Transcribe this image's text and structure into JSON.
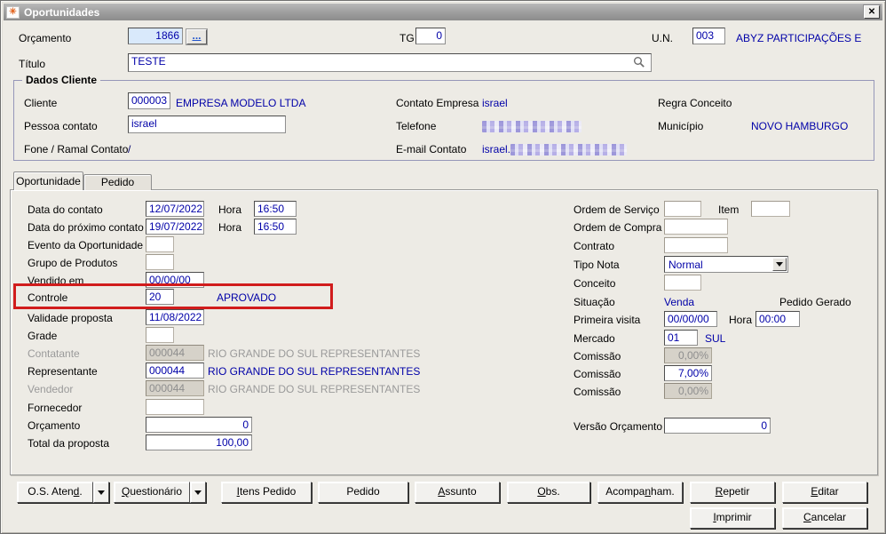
{
  "window": {
    "title": "Oportunidades"
  },
  "icons": {
    "app": "✳",
    "close": "✕"
  },
  "colors": {
    "value_text": "#0000A8",
    "highlight_red": "#D11C1C",
    "disabled_text": "#8E8E8E",
    "orcamento_bg": "#D9E9FB"
  },
  "header": {
    "orcamento_label": "Orçamento",
    "orcamento_value": "1866",
    "browse_label": "...",
    "tg_label": "TG",
    "tg_value": "0",
    "un_label": "U.N.",
    "un_value": "003",
    "un_name": "ABYZ PARTICIPAÇÕES E",
    "titulo_label": "Título",
    "titulo_value": "TESTE"
  },
  "cliente": {
    "legend": "Dados Cliente",
    "cliente_label": "Cliente",
    "cliente_code": "000003",
    "cliente_name": "EMPRESA MODELO LTDA",
    "pessoa_label": "Pessoa contato",
    "pessoa_value": "israel",
    "fone_label": "Fone / Ramal Contato",
    "fone_value": "/",
    "contato_label": "Contato Empresa",
    "contato_value": "israel",
    "telefone_label": "Telefone",
    "email_label": "E-mail Contato",
    "email_prefix": "israel.",
    "regra_label": "Regra Conceito",
    "municipio_label": "Município",
    "municipio_value": "NOVO HAMBURGO"
  },
  "tabs": {
    "oportunidade": "Oportunidade",
    "pedido": "Pedido"
  },
  "left": {
    "data_contato_label": "Data do contato",
    "data_contato": "12/07/2022",
    "hora_label": "Hora",
    "hora1": "16:50",
    "data_prox_label": "Data do próximo contato",
    "data_prox": "19/07/2022",
    "hora2": "16:50",
    "evento_label": "Evento da Oportunidade",
    "grupo_label": "Grupo de Produtos",
    "vendido_label": "Vendido em",
    "vendido": "00/00/00",
    "controle_label": "Controle",
    "controle": "20",
    "controle_status": "APROVADO",
    "validade_label": "Validade proposta",
    "validade": "11/08/2022",
    "grade_label": "Grade",
    "contatante_label": "Contatante",
    "contatante_code": "000044",
    "contatante_name": "RIO GRANDE DO SUL REPRESENTANTES",
    "representante_label": "Representante",
    "representante_code": "000044",
    "representante_name": "RIO GRANDE DO SUL REPRESENTANTES",
    "vendedor_label": "Vendedor",
    "vendedor_code": "000044",
    "vendedor_name": "RIO GRANDE DO SUL REPRESENTANTES",
    "fornecedor_label": "Fornecedor",
    "orcamento_label": "Orçamento",
    "orcamento": "0",
    "total_label": "Total da proposta",
    "total": "100,00"
  },
  "right": {
    "os_label": "Ordem de Serviço",
    "item_label": "Item",
    "oc_label": "Ordem de Compra",
    "contrato_label": "Contrato",
    "tipo_nota_label": "Tipo Nota",
    "tipo_nota": "Normal",
    "conceito_label": "Conceito",
    "situacao_label": "Situação",
    "situacao": "Venda",
    "pedido_gerado_label": "Pedido Gerado",
    "visita_label": "Primeira visita",
    "visita": "00/00/00",
    "hora_label": "Hora",
    "visita_hora": "00:00",
    "mercado_label": "Mercado",
    "mercado": "01",
    "mercado_name": "SUL",
    "comissao_label": "Comissão",
    "comissao1": "0,00%",
    "comissao2": "7,00%",
    "comissao3": "0,00%",
    "versao_label": "Versão Orçamento",
    "versao": "0"
  },
  "buttons": [
    {
      "pre": "O.S. Aten",
      "accel": "d",
      "post": "."
    },
    {
      "pre": "",
      "accel": "Q",
      "post": "uestionário"
    },
    {
      "pre": "",
      "accel": "I",
      "post": "tens Pedido"
    },
    {
      "pre": "Pedido",
      "accel": "",
      "post": ""
    },
    {
      "pre": "",
      "accel": "A",
      "post": "ssunto"
    },
    {
      "pre": "",
      "accel": "O",
      "post": "bs."
    },
    {
      "pre": "Acompa",
      "accel": "n",
      "post": "ham."
    },
    {
      "pre": "",
      "accel": "R",
      "post": "epetir"
    },
    {
      "pre": "",
      "accel": "E",
      "post": "ditar"
    },
    {
      "pre": "",
      "accel": "I",
      "post": "mprimir"
    },
    {
      "pre": "",
      "accel": "C",
      "post": "ancelar"
    }
  ]
}
